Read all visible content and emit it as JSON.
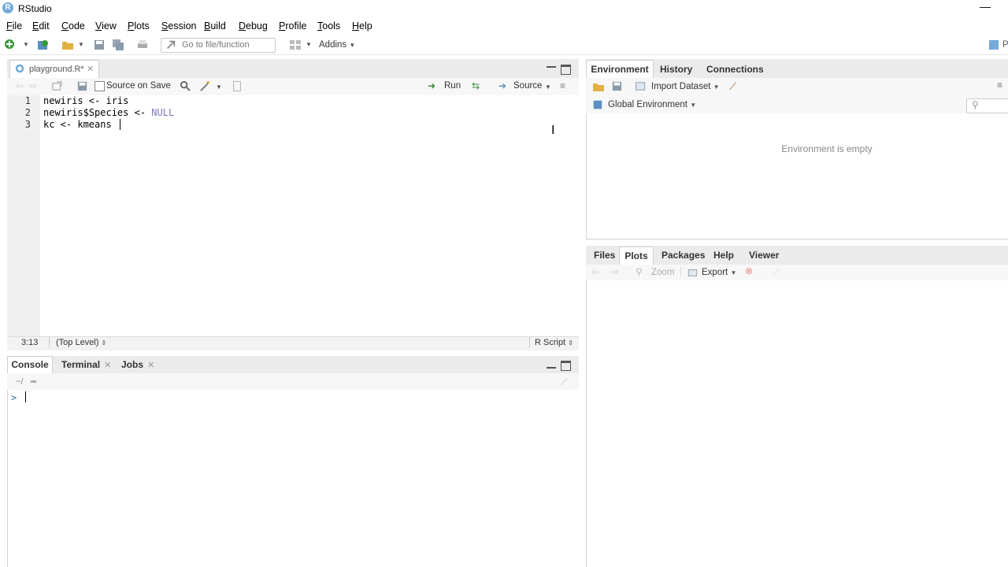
{
  "window": {
    "title": "RStudio",
    "logo_letter": "R",
    "minimize": "—"
  },
  "menu": [
    "File",
    "Edit",
    "Code",
    "View",
    "Plots",
    "Session",
    "Build",
    "Debug",
    "Profile",
    "Tools",
    "Help"
  ],
  "menu_underline": [
    "F",
    "E",
    "C",
    "V",
    "P",
    "S",
    "B",
    "D",
    "P",
    "T",
    "H"
  ],
  "menu_rest": [
    "ile",
    "dit",
    "ode",
    "iew",
    "lots",
    "ession",
    "uild",
    "ebug",
    "rofile",
    "ools",
    "elp"
  ],
  "toolbar": {
    "goto_placeholder": "Go to file/function",
    "addins": "Addins",
    "project_partial": "P"
  },
  "editor": {
    "tab_label": "playground.R*",
    "source_on_save": "Source on Save",
    "run": "Run",
    "source": "Source",
    "lines": [
      {
        "num": "1",
        "text": "newiris <- iris"
      },
      {
        "num": "2",
        "text": "newiris$Species <- ",
        "kw": "NULL"
      },
      {
        "num": "3",
        "text": "kc <- kmeans"
      }
    ],
    "status": {
      "position": "3:13",
      "scope": "(Top Level)",
      "type": "R Script"
    }
  },
  "console": {
    "tabs": [
      "Console",
      "Terminal",
      "Jobs"
    ],
    "path": "~/",
    "prompt": ">"
  },
  "environment": {
    "tabs": [
      "Environment",
      "History",
      "Connections"
    ],
    "import_dataset": "Import Dataset",
    "global_env": "Global Environment",
    "empty_msg": "Environment is empty"
  },
  "files": {
    "tabs": [
      "Files",
      "Plots",
      "Packages",
      "Help",
      "Viewer"
    ],
    "zoom": "Zoom",
    "export": "Export"
  },
  "colors": {
    "accent": "#75aadb",
    "keyword": "#7b7bb7",
    "prompt": "#2d6fa7"
  }
}
